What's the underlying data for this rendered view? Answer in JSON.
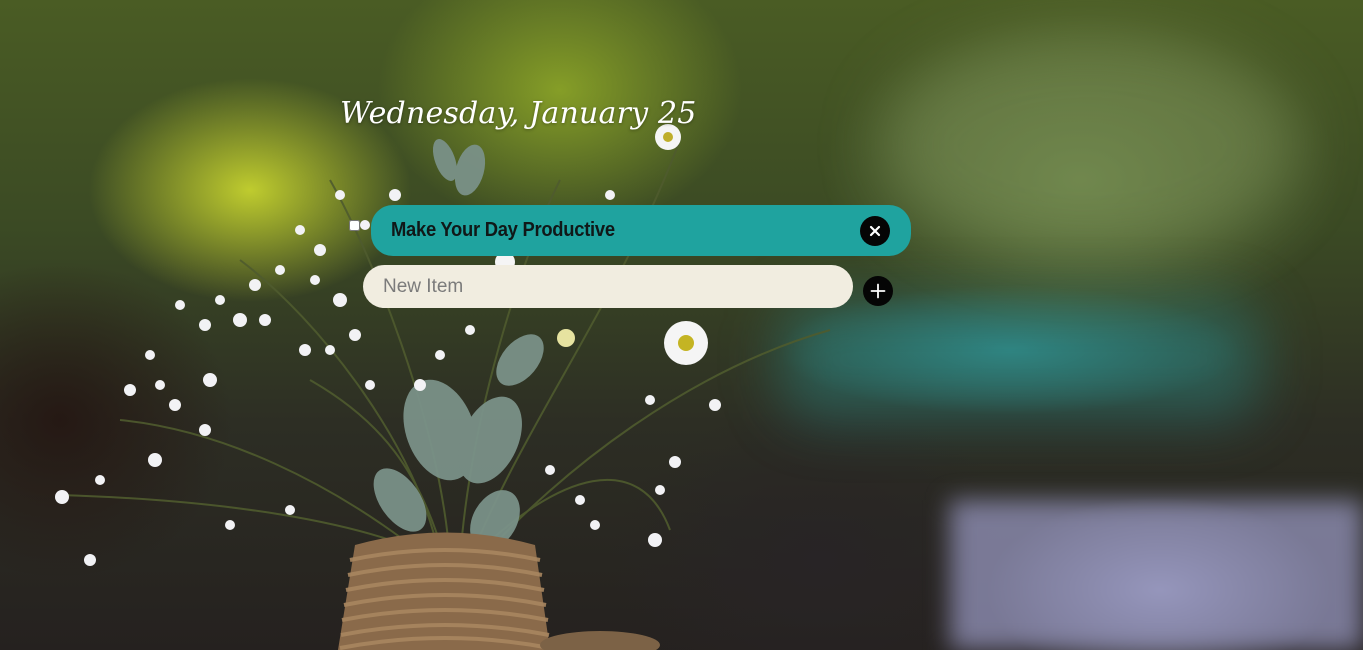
{
  "header": {
    "date": "Wednesday, January 25"
  },
  "todos": [
    {
      "text": "Make Your Day Productive",
      "completed": false
    }
  ],
  "new_item": {
    "placeholder": "New Item",
    "value": ""
  },
  "icons": {
    "delete": "close-icon",
    "add": "plus-icon",
    "checkbox": "checkbox"
  },
  "colors": {
    "todo_background": "#1fa39f",
    "input_background": "#f1ede0",
    "button_background": "#050505",
    "date_text": "#ffffff"
  }
}
